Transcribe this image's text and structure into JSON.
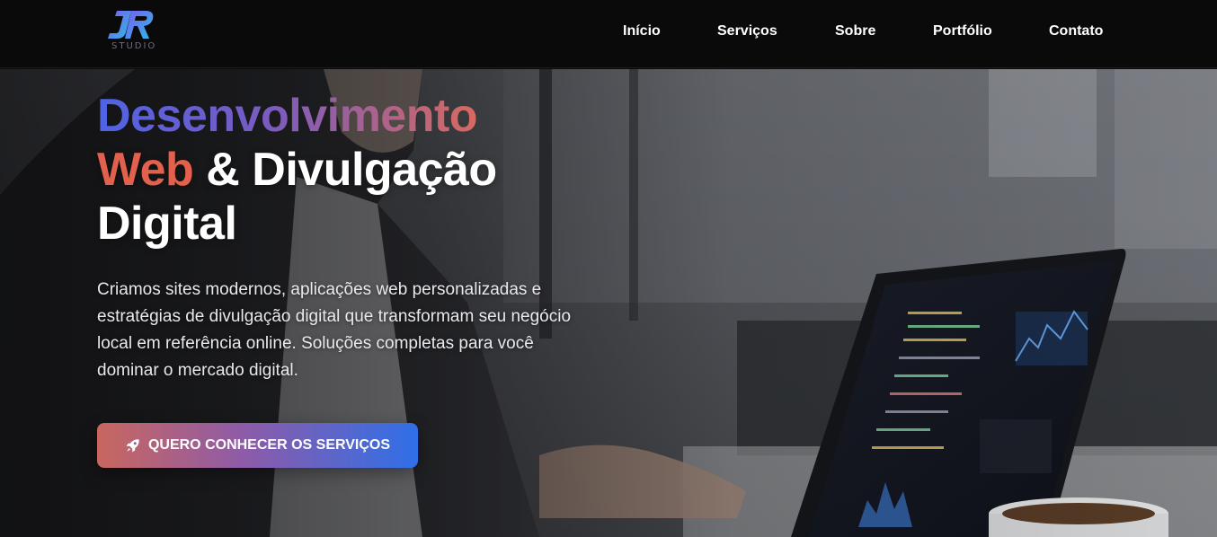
{
  "brand": {
    "logo_text": "STUDIO",
    "colors": {
      "logo_gradient_start": "#7b5cf0",
      "logo_gradient_end": "#2fb8e8"
    }
  },
  "nav": {
    "items": [
      {
        "label": "Início"
      },
      {
        "label": "Serviços"
      },
      {
        "label": "Sobre"
      },
      {
        "label": "Portfólio"
      },
      {
        "label": "Contato"
      }
    ]
  },
  "hero": {
    "title_part1": "Desenvolvimento",
    "title_part2": "Web",
    "title_part3": "& Divulgação",
    "title_part4": "Digital",
    "description": "Criamos sites modernos, aplicações web personalizadas e estratégias de divulgação digital que transformam seu negócio local em referência online. Soluções completas para você dominar o mercado digital.",
    "cta_label": "QUERO CONHECER OS SERVIÇOS",
    "cta_icon": "rocket-icon",
    "colors": {
      "title_gradient": [
        "#4f63e6",
        "#7a5bc0",
        "#d8695f"
      ],
      "web_word": "#e1614c",
      "cta_gradient": [
        "#c9675f",
        "#8f5ba7",
        "#2f6fe8"
      ]
    }
  }
}
